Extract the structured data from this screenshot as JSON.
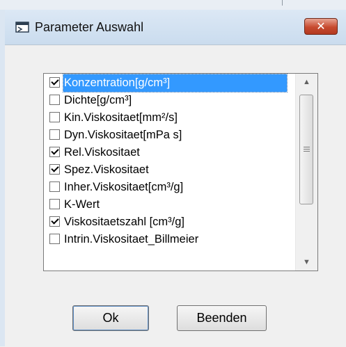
{
  "window": {
    "title": "Parameter Auswahl",
    "close_glyph": "✕",
    "icon": "window-app-icon"
  },
  "list": {
    "items": [
      {
        "label": "Konzentration[g/cm³]",
        "checked": true,
        "selected": true
      },
      {
        "label": "Dichte[g/cm³]",
        "checked": false,
        "selected": false
      },
      {
        "label": "Kin.Viskositaet[mm²/s]",
        "checked": false,
        "selected": false
      },
      {
        "label": "Dyn.Viskositaet[mPa s]",
        "checked": false,
        "selected": false
      },
      {
        "label": "Rel.Viskositaet",
        "checked": true,
        "selected": false
      },
      {
        "label": "Spez.Viskositaet",
        "checked": true,
        "selected": false
      },
      {
        "label": "Inher.Viskositaet[cm³/g]",
        "checked": false,
        "selected": false
      },
      {
        "label": "K-Wert",
        "checked": false,
        "selected": false
      },
      {
        "label": "Viskositaetszahl [cm³/g]",
        "checked": true,
        "selected": false
      },
      {
        "label": "Intrin.Viskositaet_Billmeier",
        "checked": false,
        "selected": false
      }
    ],
    "scroll_up_glyph": "▲",
    "scroll_down_glyph": "▼"
  },
  "buttons": {
    "ok_label": "Ok",
    "quit_label": "Beenden"
  },
  "colors": {
    "selection": "#3399ff",
    "close_button": "#c74a2f"
  }
}
